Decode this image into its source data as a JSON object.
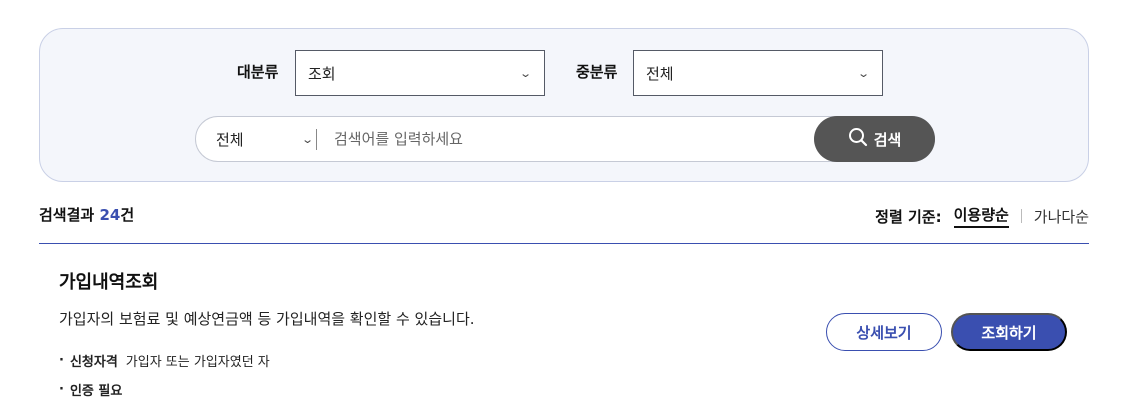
{
  "filters": {
    "major_label": "대분류",
    "major_value": "조회",
    "middle_label": "중분류",
    "middle_value": "전체"
  },
  "search": {
    "scope_value": "전체",
    "placeholder": "검색어를 입력하세요",
    "button_label": "검색"
  },
  "results": {
    "count_prefix": "검색결과 ",
    "count": "24",
    "count_suffix": "건"
  },
  "sort": {
    "label": "정렬 기준:",
    "options": [
      "이용량순",
      "가나다순"
    ],
    "active": "이용량순"
  },
  "service": {
    "title": "가입내역조회",
    "description": "가입자의 보험료 및 예상연금액 등 가입내역을 확인할 수 있습니다.",
    "eligibility_key": "신청자격",
    "eligibility_value": "가입자 또는 가입자였던 자",
    "auth_required": "인증 필요",
    "detail_button": "상세보기",
    "inquiry_button": "조회하기"
  },
  "colors": {
    "accent": "#3a4fb0",
    "panel_bg": "#f4f6fb",
    "search_button": "#555555"
  },
  "icons": {
    "chevron": "chevron-down-icon",
    "search": "search-icon"
  }
}
